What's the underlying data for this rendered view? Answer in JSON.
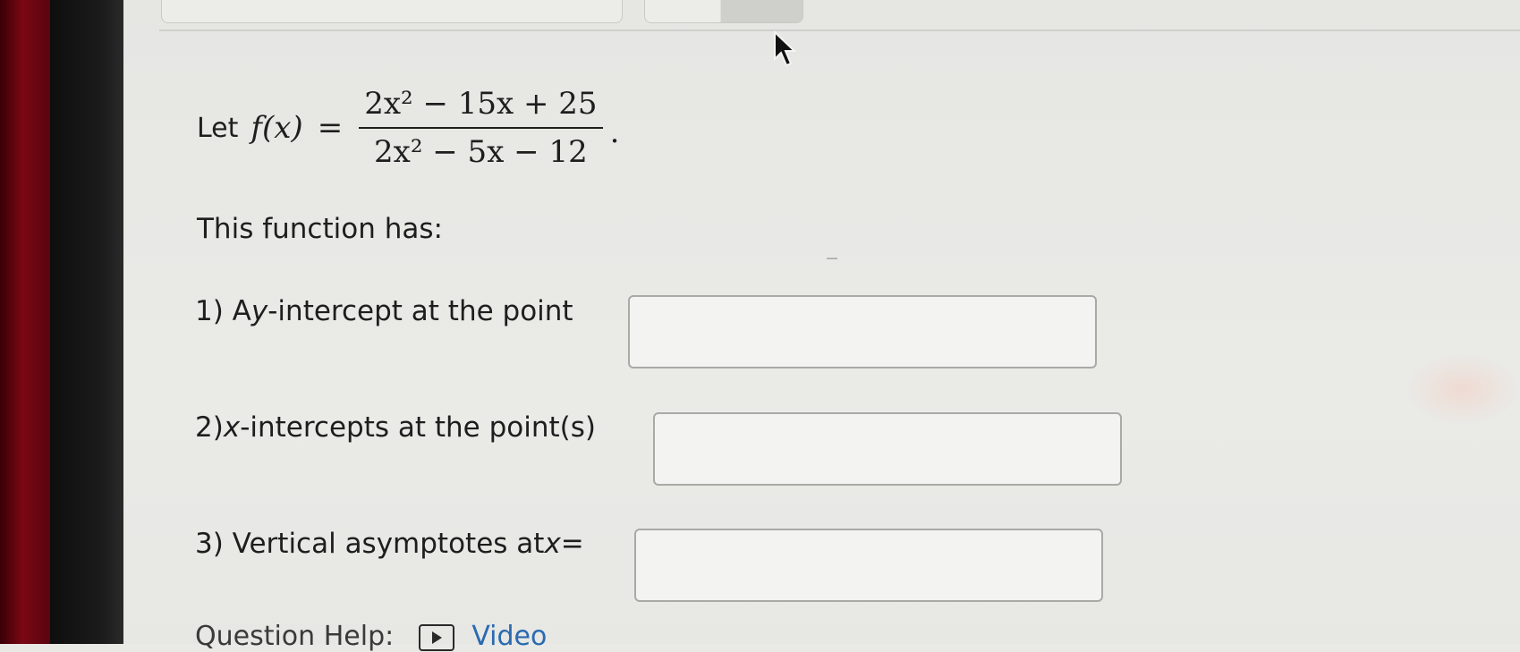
{
  "problem": {
    "let_word": "Let",
    "function_name": "f(x)",
    "equals": "=",
    "numerator": "2x² − 15x + 25",
    "denominator": "2x² − 5x − 12",
    "period": "."
  },
  "intro": "This function has:",
  "questions": [
    {
      "prefix": "1) A ",
      "var": "y",
      "suffix": "-intercept at the point",
      "answer": ""
    },
    {
      "prefix": "2) ",
      "var": "x",
      "suffix": "-intercepts at the point(s)",
      "answer": ""
    },
    {
      "prefix": "3) Vertical asymptotes at ",
      "var": "x",
      "suffix": " =",
      "answer": ""
    }
  ],
  "help": {
    "label": "Question Help:",
    "link": "Video"
  },
  "colors": {
    "link": "#2a6ab0",
    "bezel_red": "#7a0814"
  }
}
